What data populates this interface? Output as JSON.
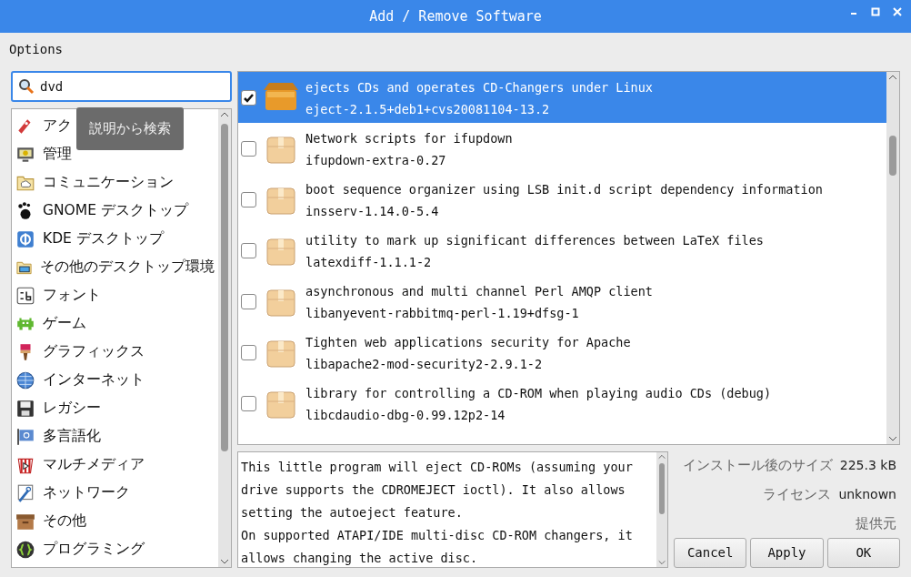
{
  "window": {
    "title": "Add / Remove Software"
  },
  "menu": "Options",
  "search": {
    "value": "dvd"
  },
  "tooltip": "説明から検索",
  "categories": [
    {
      "label": "アク"
    },
    {
      "label": "管理"
    },
    {
      "label": "コミュニケーション"
    },
    {
      "label": "GNOME デスクトップ"
    },
    {
      "label": "KDE デスクトップ"
    },
    {
      "label": "その他のデスクトップ環境"
    },
    {
      "label": "フォント"
    },
    {
      "label": "ゲーム"
    },
    {
      "label": "グラフィックス"
    },
    {
      "label": "インターネット"
    },
    {
      "label": "レガシー"
    },
    {
      "label": "多言語化"
    },
    {
      "label": "マルチメディア"
    },
    {
      "label": "ネットワーク"
    },
    {
      "label": "その他"
    },
    {
      "label": "プログラミング"
    }
  ],
  "packages": [
    {
      "summary": "ejects CDs and operates CD-Changers under Linux",
      "name": "eject-2.1.5+deb1+cvs20081104-13.2",
      "checked": true,
      "selected": true
    },
    {
      "summary": "Network scripts for ifupdown",
      "name": "ifupdown-extra-0.27",
      "checked": false,
      "selected": false
    },
    {
      "summary": "boot sequence organizer using LSB init.d script dependency information",
      "name": "insserv-1.14.0-5.4",
      "checked": false,
      "selected": false
    },
    {
      "summary": "utility to mark up significant differences between LaTeX files",
      "name": "latexdiff-1.1.1-2",
      "checked": false,
      "selected": false
    },
    {
      "summary": "asynchronous and multi channel Perl AMQP client",
      "name": "libanyevent-rabbitmq-perl-1.19+dfsg-1",
      "checked": false,
      "selected": false
    },
    {
      "summary": "Tighten web applications security for Apache",
      "name": "libapache2-mod-security2-2.9.1-2",
      "checked": false,
      "selected": false
    },
    {
      "summary": "library for controlling a CD-ROM when playing audio CDs (debug)",
      "name": "libcdaudio-dbg-0.99.12p2-14",
      "checked": false,
      "selected": false
    }
  ],
  "description": [
    "This little program will eject CD-ROMs (assuming your drive supports the CDROMEJECT ioctl). It also allows setting the autoeject feature.",
    "On supported ATAPI/IDE multi-disc CD-ROM changers, it allows changing the active disc."
  ],
  "details": [
    {
      "label": "インストール後のサイズ",
      "value": "225.3 kB"
    },
    {
      "label": "ライセンス",
      "value": "unknown"
    },
    {
      "label": "提供元"
    }
  ],
  "buttons": [
    "Cancel",
    "Apply",
    "OK"
  ]
}
